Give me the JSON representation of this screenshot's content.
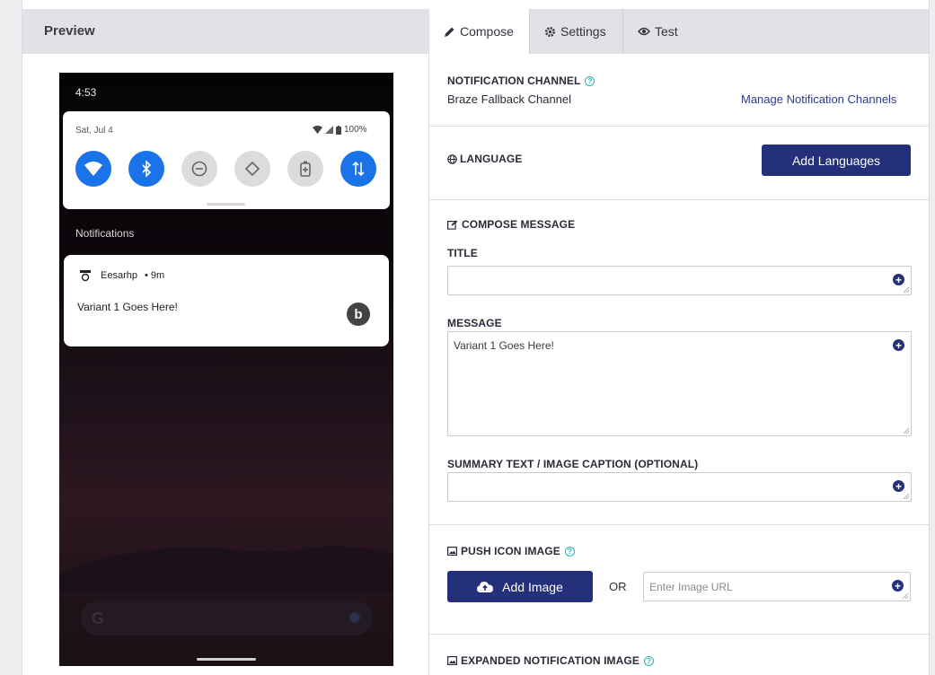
{
  "preview": {
    "title": "Preview",
    "phone": {
      "time": "4:53",
      "date": "Sat, Jul 4",
      "battery": "100%",
      "notifications_header": "Notifications",
      "app_name": "Eesarhp",
      "age": "• 9m",
      "message": "Variant 1 Goes Here!",
      "quick_settings": [
        "wifi-icon",
        "bluetooth-icon",
        "dnd-icon",
        "autorotate-icon",
        "battery-saver-icon",
        "data-icon"
      ]
    }
  },
  "tabs": [
    {
      "label": "Compose",
      "icon": "pencil-icon",
      "active": true
    },
    {
      "label": "Settings",
      "icon": "gear-icon",
      "active": false
    },
    {
      "label": "Test",
      "icon": "eye-icon",
      "active": false
    }
  ],
  "channel": {
    "label": "NOTIFICATION CHANNEL",
    "value": "Braze Fallback Channel",
    "manage_link": "Manage Notification Channels"
  },
  "language": {
    "label": "LANGUAGE",
    "add_button": "Add Languages"
  },
  "compose": {
    "label": "COMPOSE MESSAGE",
    "title_label": "TITLE",
    "title_value": "",
    "message_label": "MESSAGE",
    "message_value": "Variant 1 Goes Here!",
    "summary_label": "SUMMARY TEXT / IMAGE CAPTION (OPTIONAL)",
    "summary_value": ""
  },
  "push_icon": {
    "label": "PUSH ICON IMAGE",
    "add_button": "Add Image",
    "or_text": "OR",
    "url_placeholder": "Enter Image URL"
  },
  "expanded_image": {
    "label": "EXPANDED NOTIFICATION IMAGE"
  },
  "colors": {
    "primary": "#25307a",
    "toggle_on": "#1a73e8",
    "help": "#1fb7b7"
  }
}
